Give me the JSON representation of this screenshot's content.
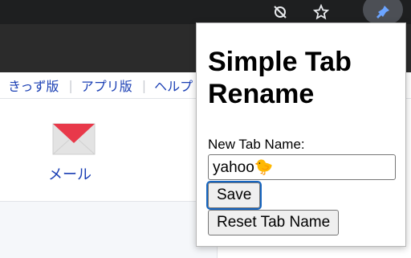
{
  "toolbar": {
    "icons": [
      "eye-off-icon",
      "star-icon",
      "pin-icon"
    ]
  },
  "webpage": {
    "service_links": [
      "きっず版",
      "アプリ版",
      "ヘルプ"
    ],
    "mail_label": "メール"
  },
  "popup": {
    "title": "Simple Tab Rename",
    "field_label": "New Tab Name:",
    "input_value": "yahoo🐤",
    "save_label": "Save",
    "reset_label": "Reset Tab Name"
  },
  "colors": {
    "toolbar_bg": "#1e1f20",
    "tabstrip_bg": "#2b2b2b",
    "link_blue": "#1a3fb4",
    "mail_red": "#e8394a",
    "focus_ring": "#1565c0"
  }
}
